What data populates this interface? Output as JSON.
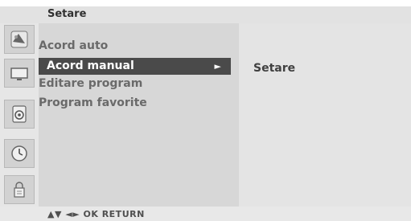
{
  "header": {
    "title": "Setare"
  },
  "icons": [
    {
      "name": "picture-icon"
    },
    {
      "name": "screen-icon"
    },
    {
      "name": "audio-icon"
    },
    {
      "name": "clock-icon"
    },
    {
      "name": "lock-icon"
    }
  ],
  "menu": {
    "items": [
      {
        "label": "Acord auto"
      },
      {
        "label": "Acord manual",
        "arrow": "►"
      },
      {
        "label": "Editare program"
      },
      {
        "label": "Program favorite"
      }
    ]
  },
  "submenu": {
    "label": "Setare"
  },
  "footer": {
    "hint": "▲▼  ◄►  OK  RETURN"
  },
  "colors": {
    "selected_bg": "#4a4a4a",
    "menu_bg": "#d7d7d7",
    "submenu_bg": "#e4e4e4",
    "bar_bg": "#e2e2e2"
  }
}
